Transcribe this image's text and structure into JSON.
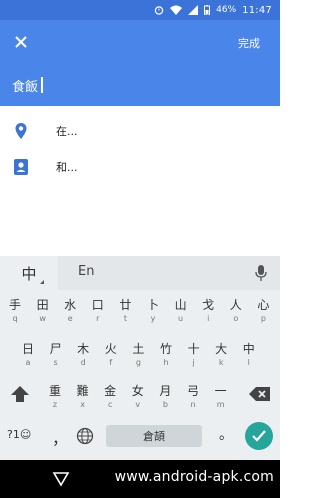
{
  "status": {
    "battery_pct": "46%",
    "time": "11:47"
  },
  "appbar": {
    "done_label": "完成"
  },
  "search": {
    "text": "食飯"
  },
  "results": [
    {
      "icon": "location-pin-icon",
      "label": "在..."
    },
    {
      "icon": "contact-card-icon",
      "label": "和..."
    }
  ],
  "keyboard": {
    "mode_zh": "中",
    "mode_en": "En",
    "rows": [
      [
        {
          "main": "手",
          "sub": "q"
        },
        {
          "main": "田",
          "sub": "w"
        },
        {
          "main": "水",
          "sub": "e"
        },
        {
          "main": "口",
          "sub": "r"
        },
        {
          "main": "廿",
          "sub": "t"
        },
        {
          "main": "卜",
          "sub": "y"
        },
        {
          "main": "山",
          "sub": "u"
        },
        {
          "main": "戈",
          "sub": "i"
        },
        {
          "main": "人",
          "sub": "o"
        },
        {
          "main": "心",
          "sub": "p"
        }
      ],
      [
        {
          "main": "日",
          "sub": "a"
        },
        {
          "main": "尸",
          "sub": "s"
        },
        {
          "main": "木",
          "sub": "d"
        },
        {
          "main": "火",
          "sub": "f"
        },
        {
          "main": "土",
          "sub": "g"
        },
        {
          "main": "竹",
          "sub": "h"
        },
        {
          "main": "十",
          "sub": "j"
        },
        {
          "main": "大",
          "sub": "k"
        },
        {
          "main": "中",
          "sub": "l"
        }
      ],
      [
        {
          "main": "重",
          "sub": "z"
        },
        {
          "main": "難",
          "sub": "x"
        },
        {
          "main": "金",
          "sub": "c"
        },
        {
          "main": "女",
          "sub": "v"
        },
        {
          "main": "月",
          "sub": "b"
        },
        {
          "main": "弓",
          "sub": "n"
        },
        {
          "main": "一",
          "sub": "m"
        }
      ]
    ],
    "symbol_key": "?1☺",
    "comma_key": "，",
    "space_label": "倉頡",
    "period_key": "。"
  },
  "watermark": "www.android-apk.com",
  "colors": {
    "appbar": "#4a86ea",
    "status": "#3b73d8",
    "enter": "#26a69a"
  }
}
